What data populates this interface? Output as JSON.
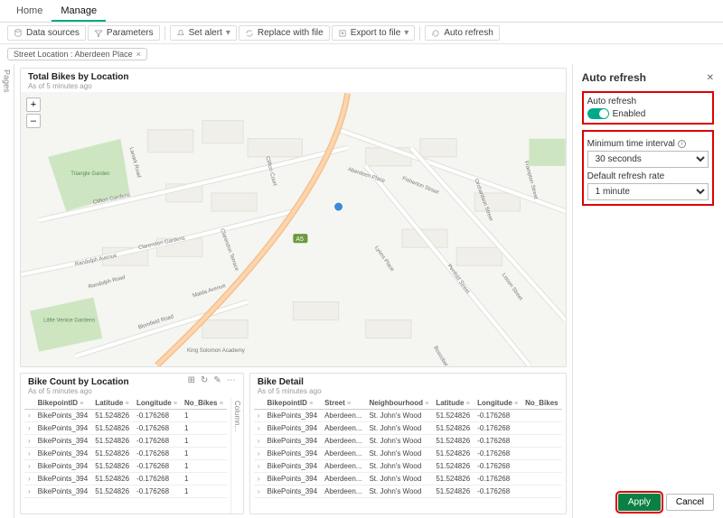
{
  "tabs": {
    "home": "Home",
    "manage": "Manage"
  },
  "toolbar": {
    "data_sources": "Data sources",
    "parameters": "Parameters",
    "set_alert": "Set alert",
    "replace": "Replace with file",
    "export": "Export to file",
    "auto_refresh": "Auto refresh"
  },
  "filter": {
    "label": "Street Location : Aberdeen Place",
    "close": "×"
  },
  "pages_rail": "Pages",
  "columns_rail": "Column...",
  "map_card": {
    "title": "Total Bikes by Location",
    "subtitle": "As of 5 minutes ago",
    "zoom_in": "+",
    "zoom_out": "–",
    "labels": {
      "triangle": "Triangle\nGarden",
      "little_venice": "Little Venice\nGardens",
      "clifton": "Clifton Gardens",
      "randolph": "Randolph Avenue",
      "blomfield": "Blomfield Road",
      "maida": "Maida Avenue",
      "aberdeen": "Aberdeen Place",
      "fisherton": "Fisherton Street",
      "orchardson": "Orchardson Street",
      "penfold": "Penfold Street",
      "lisson": "Lisson Street",
      "frampton": "Frampton Street",
      "clifton_court": "Clifton Court",
      "lanark": "Lanark Road",
      "randolph_road": "Randolph Road",
      "clarendon_gardens": "Clarendon Gardens",
      "clarendon_terrace": "Clarendon Terrace",
      "a5": "A5",
      "king_solomon": "King Solomon\nAcademy",
      "lyons_place": "Lyons Place",
      "boscobel": "Boscobel Street"
    }
  },
  "table1": {
    "title": "Bike Count by Location",
    "subtitle": "As of 5 minutes ago",
    "headers": [
      "BikepointID",
      "Latitude",
      "Longitude",
      "No_Bikes"
    ],
    "rows": [
      [
        "BikePoints_394",
        "51.524826",
        "-0.176268",
        "1"
      ],
      [
        "BikePoints_394",
        "51.524826",
        "-0.176268",
        "1"
      ],
      [
        "BikePoints_394",
        "51.524826",
        "-0.176268",
        "1"
      ],
      [
        "BikePoints_394",
        "51.524826",
        "-0.176268",
        "1"
      ],
      [
        "BikePoints_394",
        "51.524826",
        "-0.176268",
        "1"
      ],
      [
        "BikePoints_394",
        "51.524826",
        "-0.176268",
        "1"
      ],
      [
        "BikePoints_394",
        "51.524826",
        "-0.176268",
        "1"
      ]
    ]
  },
  "table2": {
    "title": "Bike Detail",
    "subtitle": "As of 5 minutes ago",
    "headers": [
      "BikepointID",
      "Street",
      "Neighbourhood",
      "Latitude",
      "Longitude",
      "No_Bikes"
    ],
    "rows": [
      [
        "BikePoints_394",
        "Aberdeen...",
        "St. John's Wood",
        "51.524826",
        "-0.176268",
        ""
      ],
      [
        "BikePoints_394",
        "Aberdeen...",
        "St. John's Wood",
        "51.524826",
        "-0.176268",
        ""
      ],
      [
        "BikePoints_394",
        "Aberdeen...",
        "St. John's Wood",
        "51.524826",
        "-0.176268",
        ""
      ],
      [
        "BikePoints_394",
        "Aberdeen...",
        "St. John's Wood",
        "51.524826",
        "-0.176268",
        ""
      ],
      [
        "BikePoints_394",
        "Aberdeen...",
        "St. John's Wood",
        "51.524826",
        "-0.176268",
        ""
      ],
      [
        "BikePoints_394",
        "Aberdeen...",
        "St. John's Wood",
        "51.524826",
        "-0.176268",
        ""
      ],
      [
        "BikePoints_394",
        "Aberdeen...",
        "St. John's Wood",
        "51.524826",
        "-0.176268",
        ""
      ]
    ]
  },
  "panel": {
    "title": "Auto refresh",
    "toggle_label_title": "Auto refresh",
    "toggle_label": "Enabled",
    "min_interval_label": "Minimum time interval",
    "min_interval_value": "30 seconds",
    "default_rate_label": "Default refresh rate",
    "default_rate_value": "1 minute",
    "apply": "Apply",
    "cancel": "Cancel",
    "close": "✕"
  }
}
